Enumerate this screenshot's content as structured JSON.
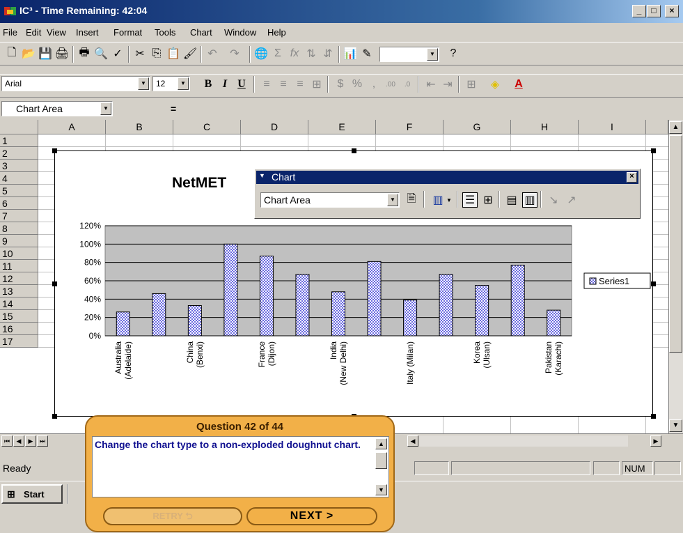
{
  "window": {
    "title": "IC³ - Time Remaining:  42:04",
    "minimize": "_",
    "maximize": "□",
    "close": "×"
  },
  "menu": [
    "File",
    "Edit",
    "View",
    "Insert",
    "Format",
    "Tools",
    "Chart",
    "Window",
    "Help"
  ],
  "formatting": {
    "font": "Arial",
    "size": "12",
    "bold": "B",
    "italic": "I",
    "underline": "U"
  },
  "formula_bar": {
    "name_box": "Chart Area",
    "equals": "="
  },
  "columns": [
    "A",
    "B",
    "C",
    "D",
    "E",
    "F",
    "G",
    "H",
    "I"
  ],
  "rows": [
    "1",
    "2",
    "3",
    "4",
    "5",
    "6",
    "7",
    "8",
    "9",
    "10",
    "11",
    "12",
    "13",
    "14",
    "15",
    "16",
    "17"
  ],
  "chart": {
    "title_visible": "NetMET",
    "legend": "Series1",
    "bar_color": "#7070e8"
  },
  "chart_data": {
    "type": "bar",
    "categories": [
      "Australia (Adelaide)",
      "",
      "China (Benxi)",
      "",
      "France (Dijon)",
      "",
      "India (New Delhi)",
      "",
      "Italy (Milan)",
      "",
      "Korea (Ulsan)",
      "",
      "Pakistan (Karachi)"
    ],
    "series": [
      {
        "name": "Series1",
        "values": [
          0.26,
          0.46,
          0.33,
          1.0,
          0.87,
          0.67,
          0.48,
          0.81,
          0.39,
          0.67,
          0.55,
          0.77,
          0.28
        ]
      }
    ],
    "yticks": [
      "0%",
      "20%",
      "40%",
      "60%",
      "80%",
      "100%",
      "120%"
    ],
    "ylim": [
      0,
      1.2
    ],
    "grid": true,
    "legend_position": "right"
  },
  "chart_toolbar": {
    "title": "Chart",
    "object_select": "Chart Area"
  },
  "status": {
    "ready": "Ready",
    "num": "NUM"
  },
  "taskbar": {
    "start": "Start"
  },
  "question": {
    "title": "Question 42 of 44",
    "text": "Change the chart type to a non-exploded doughnut chart.",
    "retry": "RETRY",
    "next": "NEXT >"
  }
}
